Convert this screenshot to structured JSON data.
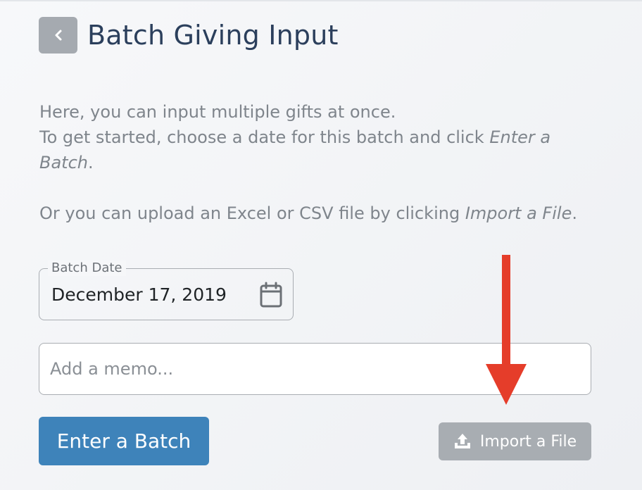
{
  "header": {
    "title": "Batch Giving Input"
  },
  "intro": {
    "line1": "Here, you can input multiple gifts at once.",
    "line2_prefix": "To get started, choose a date for this batch and click ",
    "line2_emph": "Enter a Batch",
    "line2_suffix": ".",
    "line3_prefix": "Or you can upload an Excel or CSV file by clicking ",
    "line3_emph": "Import a File",
    "line3_suffix": "."
  },
  "batch_date": {
    "label": "Batch Date",
    "value": "December 17, 2019",
    "icon": "calendar-icon"
  },
  "memo": {
    "placeholder": "Add a memo...",
    "value": ""
  },
  "actions": {
    "enter_label": "Enter a Batch",
    "import_label": "Import a File",
    "import_icon": "upload-icon"
  },
  "colors": {
    "title": "#2b3f5c",
    "primary_button": "#3e83ba",
    "secondary_button": "#a8adb2",
    "annotation_arrow": "#e53d2a"
  }
}
